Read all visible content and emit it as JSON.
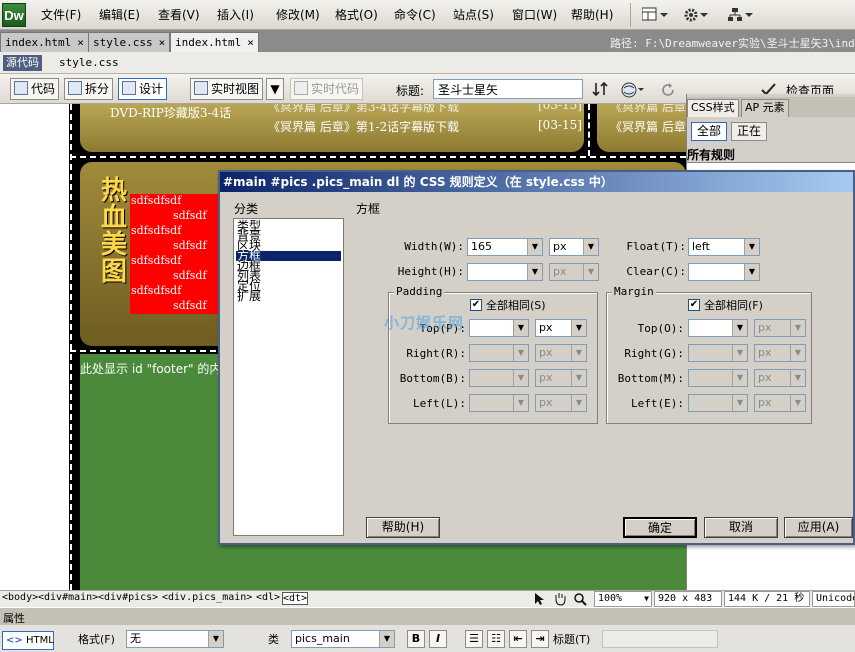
{
  "app": {
    "logo": "Dw"
  },
  "menu": [
    "文件(F)",
    "编辑(E)",
    "查看(V)",
    "插入(I)",
    "修改(M)",
    "格式(O)",
    "命令(C)",
    "站点(S)",
    "窗口(W)",
    "帮助(H)"
  ],
  "tabs": [
    {
      "label": "index.html",
      "active": false
    },
    {
      "label": "style.css",
      "active": false
    },
    {
      "label": "index.html",
      "active": true
    }
  ],
  "tab_close": "×",
  "path_label": "路径:  F:\\Dreamweaver实验\\圣斗士星矢3\\index",
  "related": {
    "source_code": "源代码",
    "file": "style.css"
  },
  "doc_toolbar": {
    "code": "代码",
    "split": "拆分",
    "design": "设计",
    "live_view": "实时视图",
    "live_code": "实时代码",
    "title_label": "标题:",
    "title_value": "圣斗士星矢",
    "check_page": "检查页面"
  },
  "canvas": {
    "header_left_1": "DVD-RIP珍藏版3-4话",
    "header_mid_1": "《冥界篇 后章》第3-4话字幕版下载",
    "header_date_1": "[03-15]",
    "header_mid_2": "《冥界篇 后章》第1-2话字幕版下载",
    "header_date_2": "[03-15]",
    "header_right_1": "《冥界篇 后章",
    "header_right_2": "《冥界篇 后章",
    "hot_beauty": "热血美图",
    "red_lines": [
      "sdfsdfsdf",
      "sdfsdf",
      "sdfsdfsdf",
      "sdfsdf",
      "sdfsdfsdf",
      "sdfsdf",
      "sdfsdfsdf",
      "sdfsdf"
    ],
    "footer_text": "此处显示 id \"footer\" 的内容"
  },
  "right_panel": {
    "tab_css": "CSS样式",
    "tab_ap": "AP 元素",
    "btn_all": "全部",
    "btn_current": "正在",
    "all_rules": "所有规则"
  },
  "status": {
    "tags": [
      "<body>",
      "<div#main>",
      "<div#pics>",
      "<div.pics_main>",
      "<dl>",
      "<dt>"
    ],
    "zoom": "100%",
    "size": "920 x 483",
    "weight": "144 K / 21 秒",
    "encoding": "Unicode"
  },
  "properties": {
    "title": "属性",
    "html_btn": "HTML",
    "format_label": "格式(F)",
    "format_value": "无",
    "class_label": "类",
    "class_value": "pics_main",
    "bold": "B",
    "italic": "I",
    "heading_label": "标题(T)"
  },
  "dialog": {
    "title": "#main #pics .pics_main dl 的 CSS 规则定义（在 style.css 中）",
    "category_label": "分类",
    "categories": [
      "类型",
      "背景",
      "区块",
      "方框",
      "边框",
      "列表",
      "定位",
      "扩展"
    ],
    "selected_category": "方框",
    "section_title": "方框",
    "width_label": "Width(W):",
    "width_value": "165",
    "width_unit": "px",
    "height_label": "Height(H):",
    "height_unit": "px",
    "float_label": "Float(T):",
    "float_value": "left",
    "clear_label": "Clear(C):",
    "padding": {
      "title": "Padding",
      "same_all": "全部相同(S)",
      "top_label": "Top(P):",
      "top_unit": "px",
      "right_label": "Right(R):",
      "right_unit": "px",
      "bottom_label": "Bottom(B):",
      "bottom_unit": "px",
      "left_label": "Left(L):",
      "left_unit": "px"
    },
    "margin": {
      "title": "Margin",
      "same_all": "全部相同(F)",
      "top_label": "Top(O):",
      "top_unit": "px",
      "right_label": "Right(G):",
      "right_unit": "px",
      "bottom_label": "Bottom(M):",
      "bottom_unit": "px",
      "left_label": "Left(E):",
      "left_unit": "px"
    },
    "check_mark": "✔",
    "help": "帮助(H)",
    "ok": "确定",
    "cancel": "取消",
    "apply": "应用(A)"
  },
  "watermark": "小刀娱乐网"
}
